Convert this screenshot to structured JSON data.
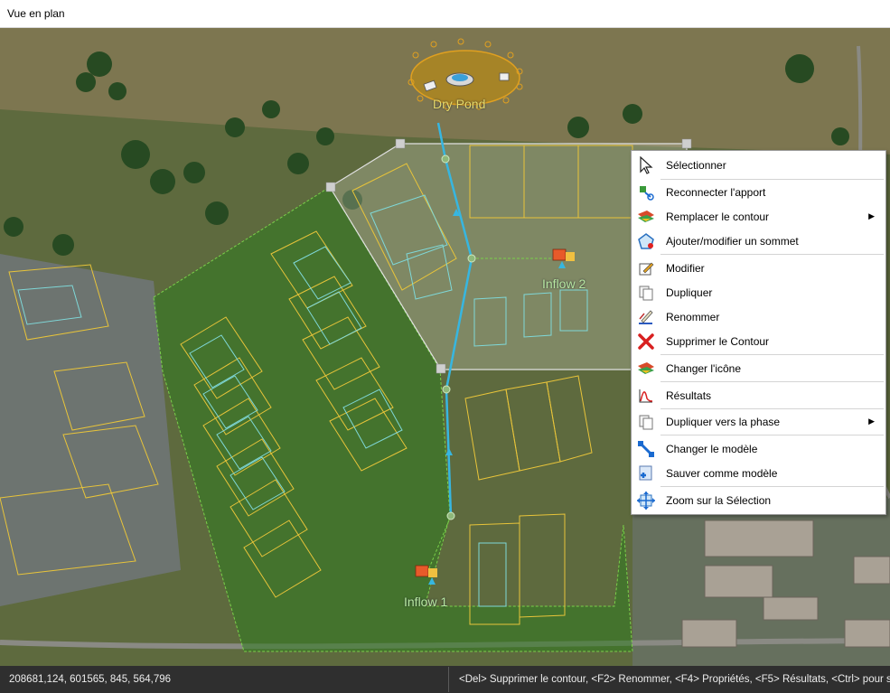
{
  "window": {
    "title": "Vue en plan"
  },
  "map": {
    "labels": {
      "dry_pond": "Dry Pond",
      "inflow_1": "Inflow 1",
      "inflow_2": "Inflow 2"
    },
    "colors": {
      "flow_line": "#37b6e0",
      "selection_outline": "#e0e0e0",
      "catchment_fill": "#2f7a1f",
      "parcel_yellow": "#e8c43a",
      "parcel_cyan": "#7fd8d8",
      "pond_outline": "#e0a020"
    }
  },
  "context_menu": {
    "items": [
      {
        "label": "Sélectionner",
        "icon": "cursor-icon"
      },
      {
        "label": "Reconnecter l'apport",
        "icon": "reconnect-icon"
      },
      {
        "label": "Remplacer le contour",
        "icon": "replace-contour-icon",
        "submenu": true
      },
      {
        "label": "Ajouter/modifier un sommet",
        "icon": "vertex-icon"
      },
      {
        "label": "Modifier",
        "icon": "edit-icon"
      },
      {
        "label": "Dupliquer",
        "icon": "duplicate-icon"
      },
      {
        "label": "Renommer",
        "icon": "rename-icon"
      },
      {
        "label": "Supprimer le Contour",
        "icon": "delete-icon"
      },
      {
        "label": "Changer l'icône",
        "icon": "change-icon-icon"
      },
      {
        "label": "Résultats",
        "icon": "results-icon"
      },
      {
        "label": "Dupliquer vers la phase",
        "icon": "duplicate-phase-icon",
        "submenu": true
      },
      {
        "label": "Changer le modèle",
        "icon": "change-model-icon"
      },
      {
        "label": "Sauver comme modèle",
        "icon": "save-model-icon"
      },
      {
        "label": "Zoom sur la Sélection",
        "icon": "zoom-selection-icon"
      }
    ]
  },
  "statusbar": {
    "coordinates": "208681,124, 601565, 845, 564,796",
    "hint": "<Del> Supprimer le contour, <F2> Renommer, <F4> Propriétés, <F5> Résultats, <Ctrl> pour supprimer"
  }
}
